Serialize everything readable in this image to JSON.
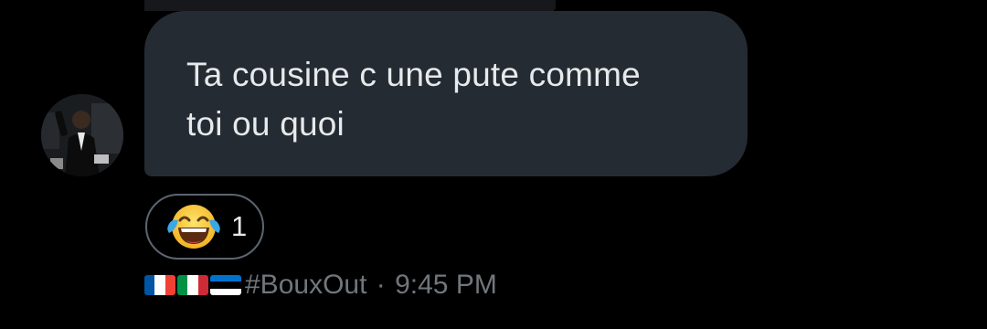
{
  "message": {
    "text": "Ta cousine c une pute comme\ntoi ou quoi"
  },
  "reaction": {
    "emoji": "face-with-tears-of-joy",
    "count": "1"
  },
  "meta": {
    "flags": [
      {
        "country": "France",
        "colors": [
          "#0055A4",
          "#FFFFFF",
          "#EF4135"
        ]
      },
      {
        "country": "Italy",
        "colors": [
          "#009246",
          "#FFFFFF",
          "#CE2B37"
        ]
      },
      {
        "country": "Estonia",
        "colors": [
          "#0072CE",
          "#000000",
          "#FFFFFF"
        ]
      }
    ],
    "hashtag": "#BouxOut",
    "separator": " · ",
    "time": "9:45 PM"
  },
  "colors": {
    "background": "#000000",
    "bubble": "#242b33",
    "text": "#e7e9ea",
    "muted": "#71767b",
    "pill_border": "#5b6570"
  }
}
